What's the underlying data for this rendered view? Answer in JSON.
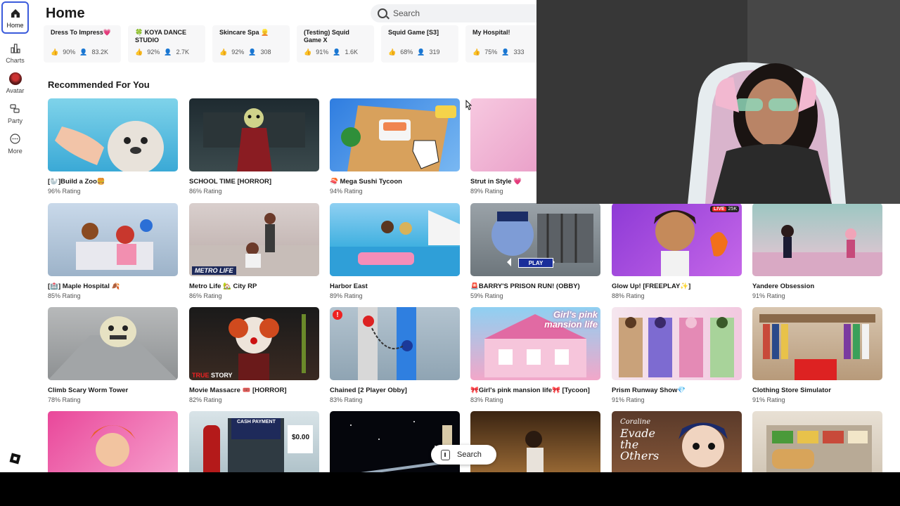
{
  "sidebar": {
    "items": [
      {
        "label": "Home",
        "icon": "home-icon"
      },
      {
        "label": "Charts",
        "icon": "charts-icon"
      },
      {
        "label": "Avatar",
        "icon": "avatar-icon"
      },
      {
        "label": "Party",
        "icon": "party-icon"
      },
      {
        "label": "More",
        "icon": "more-icon"
      }
    ]
  },
  "header": {
    "title": "Home",
    "search_placeholder": "Search"
  },
  "top_strip": [
    {
      "title": "Dress To Impress💗",
      "rating": "90%",
      "players": "83.2K"
    },
    {
      "title": "🍀 KOYA DANCE STUDIO",
      "rating": "92%",
      "players": "2.7K"
    },
    {
      "title": "Skincare Spa 👱",
      "rating": "92%",
      "players": "308"
    },
    {
      "title": "(Testing) Squid Game X",
      "rating": "91%",
      "players": "1.6K"
    },
    {
      "title": "Squid Game [S3]",
      "rating": "68%",
      "players": "319"
    },
    {
      "title": "My Hospital!",
      "rating": "75%",
      "players": "333"
    }
  ],
  "recommended": {
    "title": "Recommended For You",
    "games": [
      {
        "name": "[🦭]Build a Zoo🍔",
        "rating": "96% Rating"
      },
      {
        "name": "SCHOOL TIME [HORROR]",
        "rating": "86% Rating"
      },
      {
        "name": "🍣 Mega Sushi Tycoon",
        "rating": "94% Rating"
      },
      {
        "name": "Strut in Style 💗",
        "rating": "89% Rating"
      },
      {
        "name": "[🏥] Maple Hospital 🍂",
        "rating": "85% Rating"
      },
      {
        "name": "Metro Life 🏡 City RP",
        "rating": "86% Rating"
      },
      {
        "name": "Harbor East",
        "rating": "89% Rating"
      },
      {
        "name": "🚨BARRY'S PRISON RUN! (OBBY)",
        "rating": "59% Rating"
      },
      {
        "name": "Glow Up! [FREEPLAY✨]",
        "rating": "88% Rating"
      },
      {
        "name": "Yandere Obsession",
        "rating": "91% Rating"
      },
      {
        "name": "Climb Scary Worm Tower",
        "rating": "78% Rating"
      },
      {
        "name": "Movie Massacre 🎟️ [HORROR]",
        "rating": "82% Rating"
      },
      {
        "name": "Chained [2 Player Obby]",
        "rating": "83% Rating"
      },
      {
        "name": "🎀Girl's pink mansion life🎀 [Tycoon]",
        "rating": "83% Rating"
      },
      {
        "name": "Prism Runway Show💎",
        "rating": "91% Rating"
      },
      {
        "name": "Clothing Store Simulator",
        "rating": "91% Rating"
      }
    ]
  },
  "thumb_text": {
    "metro_life": "METRO LIFE",
    "true_story_a": "TRUE",
    "true_story_b": " STORY",
    "prison_play": "PLAY",
    "live": "LIVE",
    "live_count": "25K",
    "pink_mansion": "Girl's pink mansion life",
    "coraline_a": "Coraline",
    "coraline_b": "Evade the Others",
    "cash_payment": "CASH PAYMENT",
    "price": "$0.00"
  },
  "floating_search": {
    "label": "Search"
  }
}
